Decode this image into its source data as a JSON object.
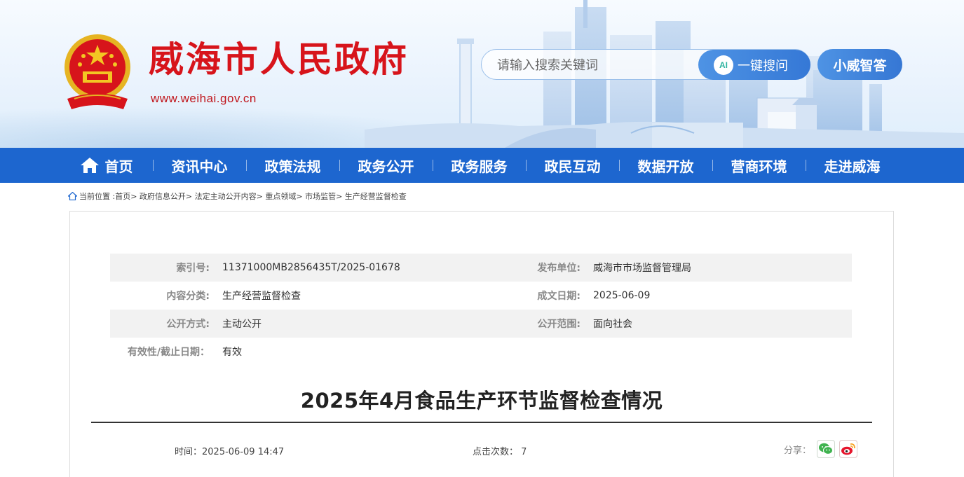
{
  "header": {
    "site_name": "威海市人民政府",
    "site_url": "www.weihai.gov.cn",
    "search_placeholder": "请输入搜索关键词",
    "ai_button_label": "一键搜问",
    "ai_icon_text": "AI",
    "assistant_button_label": "小威智答",
    "brand_color": "#d7141b"
  },
  "nav": {
    "color": "#1d66cf",
    "items": [
      {
        "label": "首页"
      },
      {
        "label": "资讯中心"
      },
      {
        "label": "政策法规"
      },
      {
        "label": "政务公开"
      },
      {
        "label": "政务服务"
      },
      {
        "label": "政民互动"
      },
      {
        "label": "数据开放"
      },
      {
        "label": "营商环境"
      },
      {
        "label": "走进威海"
      }
    ]
  },
  "breadcrumb": {
    "prefix": "当前位置 :",
    "items": [
      "首页",
      "政府信息公开",
      "法定主动公开内容",
      "重点领域",
      "市场监管",
      "生产经营监督检查"
    ],
    "separator": ">"
  },
  "meta": {
    "rows": [
      {
        "label_left": "索引号:",
        "value_left": "11371000MB2856435T/2025-01678",
        "label_right": "发布单位:",
        "value_right": "威海市市场监督管理局"
      },
      {
        "label_left": "内容分类:",
        "value_left": "生产经营监督检查",
        "label_right": "成文日期:",
        "value_right": "2025-06-09"
      },
      {
        "label_left": "公开方式:",
        "value_left": "主动公开",
        "label_right": "公开范围:",
        "value_right": "面向社会"
      },
      {
        "label_left": "有效性/截止日期：",
        "value_left": "有效",
        "label_right": "",
        "value_right": ""
      }
    ]
  },
  "article": {
    "title": "2025年4月食品生产环节监督检查情况",
    "time_label": "时间：",
    "time_value": "2025-06-09 14:47",
    "clicks_label": "点击次数：",
    "clicks_value": "7",
    "share_label": "分享："
  }
}
